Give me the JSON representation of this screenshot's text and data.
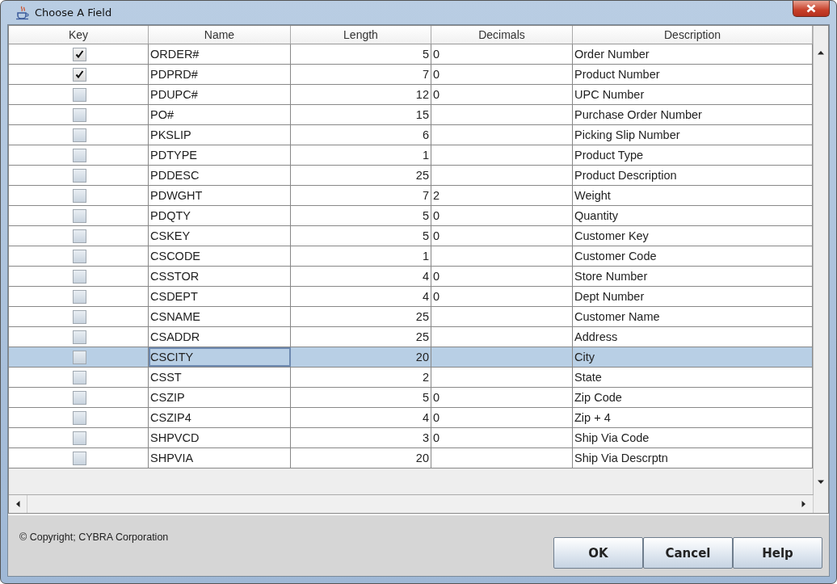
{
  "window": {
    "title": "Choose A Field"
  },
  "table": {
    "columns": [
      "Key",
      "Name",
      "Length",
      "Decimals",
      "Description"
    ],
    "rows": [
      {
        "key": true,
        "name": "ORDER#",
        "length": "5",
        "decimals": "0",
        "description": "Order Number",
        "selected": false
      },
      {
        "key": true,
        "name": "PDPRD#",
        "length": "7",
        "decimals": "0",
        "description": "Product Number",
        "selected": false
      },
      {
        "key": false,
        "name": "PDUPC#",
        "length": "12",
        "decimals": "0",
        "description": "UPC Number",
        "selected": false
      },
      {
        "key": false,
        "name": "PO#",
        "length": "15",
        "description": "Purchase Order Number",
        "selected": false
      },
      {
        "key": false,
        "name": "PKSLIP",
        "length": "6",
        "description": "Picking Slip Number",
        "selected": false
      },
      {
        "key": false,
        "name": "PDTYPE",
        "length": "1",
        "description": "Product Type",
        "selected": false
      },
      {
        "key": false,
        "name": "PDDESC",
        "length": "25",
        "description": "Product Description",
        "selected": false
      },
      {
        "key": false,
        "name": "PDWGHT",
        "length": "7",
        "decimals": "2",
        "description": "Weight",
        "selected": false
      },
      {
        "key": false,
        "name": "PDQTY",
        "length": "5",
        "decimals": "0",
        "description": "Quantity",
        "selected": false
      },
      {
        "key": false,
        "name": "CSKEY",
        "length": "5",
        "decimals": "0",
        "description": "Customer Key",
        "selected": false
      },
      {
        "key": false,
        "name": "CSCODE",
        "length": "1",
        "description": "Customer Code",
        "selected": false
      },
      {
        "key": false,
        "name": "CSSTOR",
        "length": "4",
        "decimals": "0",
        "description": "Store Number",
        "selected": false
      },
      {
        "key": false,
        "name": "CSDEPT",
        "length": "4",
        "decimals": "0",
        "description": "Dept Number",
        "selected": false
      },
      {
        "key": false,
        "name": "CSNAME",
        "length": "25",
        "description": "Customer Name",
        "selected": false
      },
      {
        "key": false,
        "name": "CSADDR",
        "length": "25",
        "description": "Address",
        "selected": false
      },
      {
        "key": false,
        "name": "CSCITY",
        "length": "20",
        "description": "City",
        "selected": true
      },
      {
        "key": false,
        "name": "CSST",
        "length": "2",
        "description": "State",
        "selected": false
      },
      {
        "key": false,
        "name": "CSZIP",
        "length": "5",
        "decimals": "0",
        "description": "Zip Code",
        "selected": false
      },
      {
        "key": false,
        "name": "CSZIP4",
        "length": "4",
        "decimals": "0",
        "description": "Zip + 4",
        "selected": false
      },
      {
        "key": false,
        "name": "SHPVCD",
        "length": "3",
        "decimals": "0",
        "description": "Ship Via Code",
        "selected": false
      },
      {
        "key": false,
        "name": "SHPVIA",
        "length": "20",
        "description": "Ship Via Descrptn",
        "selected": false
      }
    ]
  },
  "footer": {
    "copyright": "© Copyright; CYBRA Corporation",
    "buttons": [
      "OK",
      "Cancel",
      "Help"
    ]
  }
}
